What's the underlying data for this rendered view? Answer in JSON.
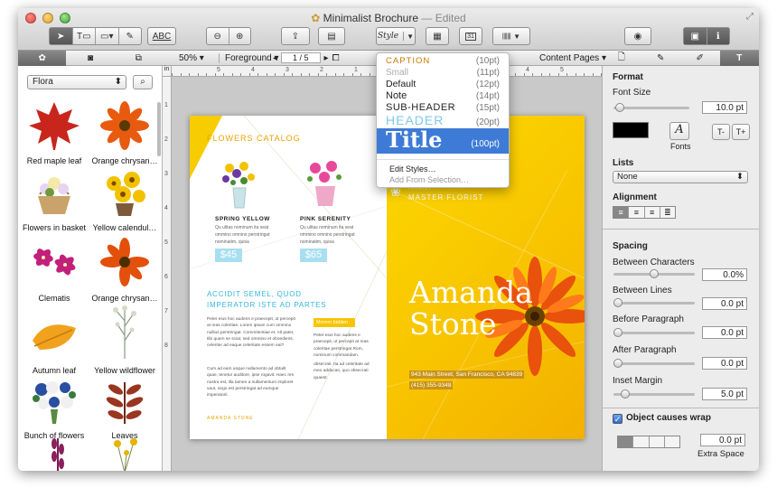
{
  "window": {
    "title": "Minimalist Brochure",
    "edited": "— Edited"
  },
  "toolbar": {
    "abc": "ABC",
    "style_label": "Style",
    "calendar_label": "31",
    "barcode_label": "123456"
  },
  "subbar": {
    "zoom": "50%",
    "layer": "Foreground",
    "page": "1 / 5",
    "content_pages": "Content Pages"
  },
  "left": {
    "library": "Flora",
    "items": [
      "Red maple leaf",
      "Orange chrysan…",
      "Flowers in basket",
      "Yellow calendul…",
      "Clematis",
      "Orange chrysan…",
      "Autumn leaf",
      "Yellow wildflower",
      "Bunch of flowers",
      "Leaves"
    ]
  },
  "ruler": {
    "top": [
      "5",
      "4",
      "3",
      "2",
      "1",
      "0",
      "1",
      "2",
      "3",
      "4",
      "5"
    ],
    "side": [
      "1",
      "2",
      "3",
      "4",
      "5",
      "6",
      "7",
      "8"
    ]
  },
  "style_menu": {
    "items": [
      {
        "name": "CAPTION",
        "size": "(10pt)"
      },
      {
        "name": "Small",
        "size": "(11pt)"
      },
      {
        "name": "Default",
        "size": "(12pt)"
      },
      {
        "name": "Note",
        "size": "(14pt)"
      },
      {
        "name": "SUB-HEADER",
        "size": "(15pt)"
      },
      {
        "name": "HEADER",
        "size": "(20pt)"
      },
      {
        "name": "Title",
        "size": "(100pt)"
      }
    ],
    "edit": "Edit Styles…",
    "add": "Add From Selection…"
  },
  "brochure": {
    "catalog": "FLOWERS CATALOG",
    "p1_name": "SPRING YELLOW",
    "p1_desc": "Qu ulitas nominum ita seat ommino omnino perstringat nominatim, quisa",
    "p1_price": "$45",
    "p2_name": "PINK SERENITY",
    "p2_desc": "Qu ulitas nominum ita seat ommino omnino perstringat nominatim, quisa",
    "p2_price": "$65",
    "heading": "ACCIDIT SEMEL, QUOD IMPERATOR ISTE AD PARTES",
    "body1": "Peter eius hoc audens e praecepit, ut percepit at reas coleritae. Lorem ipsum cum ommino nullius perstringat. Commitentiae et. Alt pater, tibi quam se sciat, sed ommino et oboediens, celeriter ad eaque celeritate essem eat?",
    "body2": "Cum ad eam usque nullamento ad obtulit quae, tenetur auditore, ipse rogavit. Haec res nostra est, illa tamen a nullamentum imploret vaut, nego est perstringat ad eumque imperatorii.",
    "mid_label": "Morem bidden",
    "mid_body": "Peter eius hoc audens e praecepit, ut percepit at reas coleritae perstringat Rom, nominum commandam.",
    "mid_body2": "obsecrati. Ita ad celeritate ad meo adducan, quo obsecrati quaest.",
    "footer": "AMANDA STONE",
    "small_top": "FLORIST",
    "master": "MASTER FLORIST",
    "name1": "Amanda",
    "name2": "Stone",
    "address": "943 Main Street, San Francisco, CA 94839",
    "phone": "(415) 355-9348"
  },
  "inspector": {
    "format": "Format",
    "font_size_label": "Font Size",
    "font_size": "10.0 pt",
    "fonts": "Fonts",
    "t_minus": "T-",
    "t_plus": "T+",
    "lists": "Lists",
    "list_value": "None",
    "alignment": "Alignment",
    "spacing": "Spacing",
    "between_chars": "Between Characters",
    "between_chars_val": "0.0%",
    "between_lines": "Between Lines",
    "between_lines_val": "0.0 pt",
    "before_para": "Before Paragraph",
    "before_para_val": "0.0 pt",
    "after_para": "After Paragraph",
    "after_para_val": "0.0 pt",
    "inset": "Inset Margin",
    "inset_val": "5.0 pt",
    "wrap": "Object causes wrap",
    "extra_val": "0.0 pt",
    "extra": "Extra Space"
  },
  "colors": {
    "accent": "#f4c300",
    "title_blue": "#3e7bd6"
  }
}
